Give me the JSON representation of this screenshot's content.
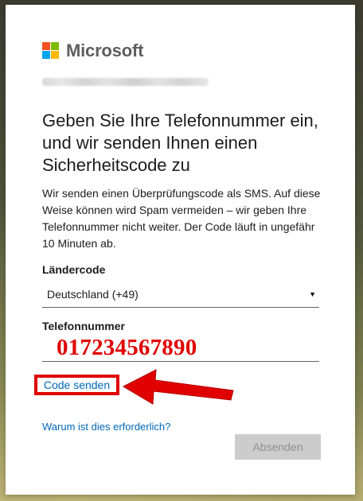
{
  "brand": {
    "name": "Microsoft",
    "logo_colors": [
      "#f25022",
      "#7fba00",
      "#00a4ef",
      "#ffb900"
    ]
  },
  "account": {
    "email_redacted": true
  },
  "header": {
    "title": "Geben Sie Ihre Telefonnummer ein, und wir senden Ihnen einen Sicherheitscode zu"
  },
  "content": {
    "description": "Wir senden einen Überprüfungscode als SMS. Auf diese Weise können wird Spam vermeiden – wir geben Ihre Telefonnummer nicht weiter. Der Code läuft in ungefähr 10 Minuten ab."
  },
  "form": {
    "country_label": "Ländercode",
    "country_value": "Deutschland (+49)",
    "phone_label": "Telefonnummer",
    "phone_value": "017234567890"
  },
  "actions": {
    "send_code_label": "Code senden",
    "why_label": "Warum ist dies erforderlich?",
    "submit_label": "Absenden",
    "submit_disabled": true
  },
  "annotation": {
    "highlight_color": "#e00000"
  }
}
